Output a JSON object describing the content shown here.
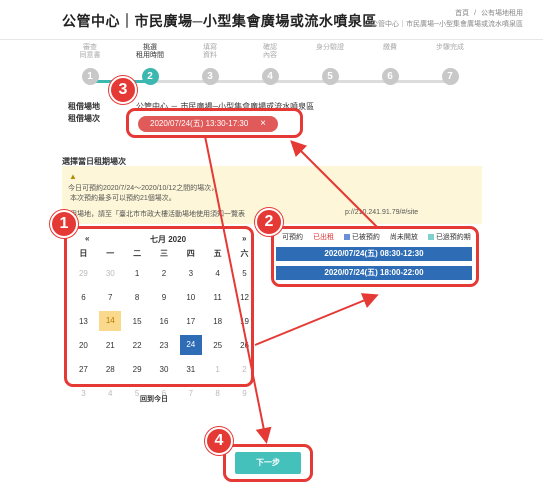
{
  "header": {
    "title": "公管中心｜市民廣場─小型集會廣場或流水噴泉區",
    "breadcrumb": [
      "首頁",
      "公有場地租用",
      "公管中心｜市民廣場─小型集會廣場或流水噴泉區"
    ],
    "breadcrumb_sep": "/"
  },
  "steps": [
    {
      "label": "審查\n同意書",
      "num": "1"
    },
    {
      "label": "挑選\n租用時間",
      "num": "2"
    },
    {
      "label": "填寫\n資料",
      "num": "3"
    },
    {
      "label": "確認\n內容",
      "num": "4"
    },
    {
      "label": "身分驗證",
      "num": "5"
    },
    {
      "label": "繳費",
      "num": "6"
    },
    {
      "label": "步驟完成",
      "num": "7"
    }
  ],
  "booking": {
    "place_label": "租借場地",
    "place_value": "公管中心 － 市民廣場─小型集會廣場或流水噴泉區",
    "slot_label": "租借場次",
    "selected_slot": "2020/07/24(五) 13:30-17:30",
    "remove_icon": "×"
  },
  "section_title": "選擇當日租期場次",
  "notice": {
    "icon": "▲",
    "line1": "今日可預約2020/7/24～2020/10/12之間的場次，",
    "line2": "本次預約最多可以預約21個場次。",
    "line3": "用場地，請至「臺北市市政大樓活動場地使用須知一覽表",
    "url": "p://210.241.91.79/#/site"
  },
  "calendar": {
    "prev": "«",
    "next": "»",
    "title": "七月 2020",
    "weekdays": [
      "日",
      "一",
      "二",
      "三",
      "四",
      "五",
      "六"
    ],
    "weeks": [
      [
        "29",
        "30",
        "1",
        "2",
        "3",
        "4",
        "5"
      ],
      [
        "6",
        "7",
        "8",
        "9",
        "10",
        "11",
        "12"
      ],
      [
        "13",
        "14",
        "15",
        "16",
        "17",
        "18",
        "19"
      ],
      [
        "20",
        "21",
        "22",
        "23",
        "24",
        "25",
        "26"
      ],
      [
        "27",
        "28",
        "29",
        "30",
        "31",
        "1",
        "2"
      ],
      [
        "3",
        "4",
        "5",
        "6",
        "7",
        "8",
        "9"
      ]
    ],
    "today": "14",
    "selected": "24",
    "back_today": "回到今日"
  },
  "legend": {
    "available": "可預約",
    "booked": "已出租",
    "reserved": "已被預約",
    "closed": "尚未開放",
    "expired": "已過預約期",
    "colors": {
      "booked": "#dd3333",
      "reserved": "#6a8fd6",
      "expired": "#7fd1ce"
    }
  },
  "slots": [
    "2020/07/24(五) 08:30-12:30",
    "2020/07/24(五) 18:00-22:00"
  ],
  "next_button": "下一步",
  "annotations": [
    "1",
    "2",
    "3",
    "4"
  ],
  "colors": {
    "accent": "#3cb8b0",
    "highlight": "#e53935",
    "slot": "#2e6db5"
  }
}
